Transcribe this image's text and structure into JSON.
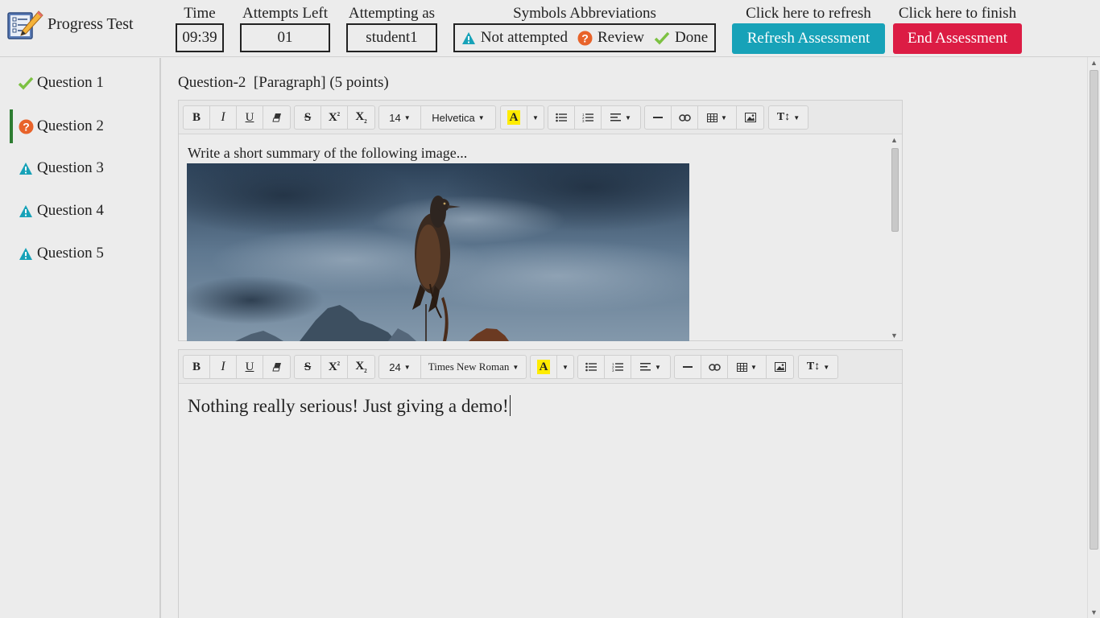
{
  "app": {
    "title": "Progress Test",
    "logo_icon": "checklist-pencil-icon"
  },
  "header": {
    "time_label": "Time",
    "time_value": "09:39",
    "attempts_label": "Attempts Left",
    "attempts_value": "01",
    "user_label": "Attempting as",
    "user_value": "student1",
    "symbols_label": "Symbols Abbreviations",
    "symbols": [
      {
        "icon": "warning-icon",
        "text": "Not attempted",
        "color": "#17a2b8"
      },
      {
        "icon": "question-circle-icon",
        "text": "Review",
        "color": "#e8632a"
      },
      {
        "icon": "check-icon",
        "text": "Done",
        "color": "#7cc142"
      }
    ],
    "refresh_label": "Click here to refresh",
    "refresh_button": "Refresh Assessment",
    "refresh_color": "#17a2b8",
    "finish_label": "Click here to finish",
    "end_button": "End Assessment",
    "end_color": "#dc1c44"
  },
  "sidebar": {
    "items": [
      {
        "label": "Question 1",
        "status": "done"
      },
      {
        "label": "Question 2",
        "status": "review",
        "active": true
      },
      {
        "label": "Question 3",
        "status": "not-attempted"
      },
      {
        "label": "Question 4",
        "status": "not-attempted"
      },
      {
        "label": "Question 5",
        "status": "not-attempted"
      }
    ]
  },
  "question": {
    "title": "Question-2  [Paragraph] (5 points)",
    "prompt": "Write a short summary of the following image...",
    "image_icon": "cormorant-bird-photo"
  },
  "editor1": {
    "font_size": "14",
    "font_family": "Helvetica"
  },
  "editor2": {
    "font_size": "24",
    "font_family": "Times New Roman"
  },
  "answer": {
    "text": "Nothing really serious! Just giving a demo!"
  }
}
